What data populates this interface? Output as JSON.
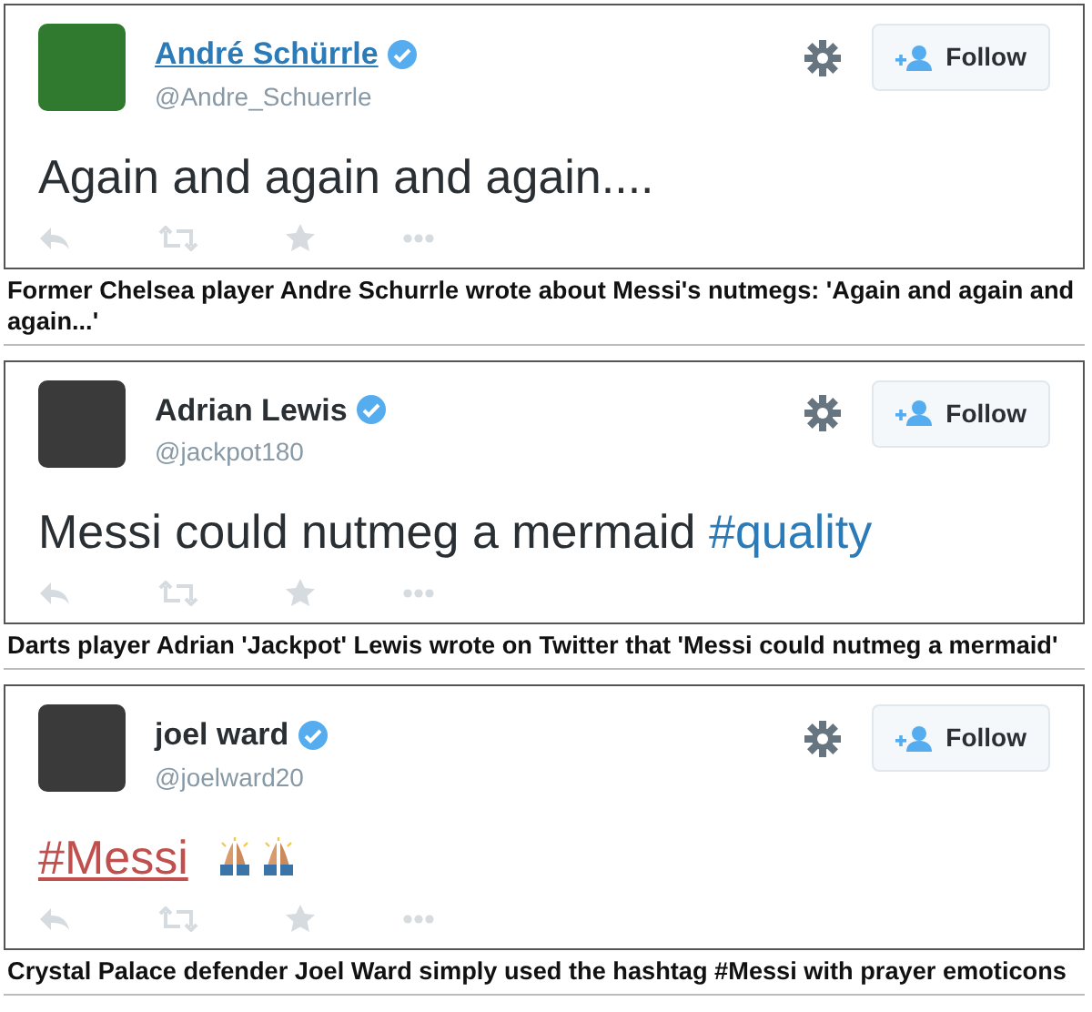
{
  "embeds": [
    {
      "tweet": {
        "name": "André Schürrle",
        "name_hovered": true,
        "handle": "@Andre_Schuerrle",
        "verified": true,
        "follow_label": "Follow",
        "text": [
          {
            "kind": "plain",
            "t": "Again and again and again...."
          }
        ]
      },
      "caption": "Former Chelsea player Andre Schurrle wrote about Messi's nutmegs: 'Again and again and again...'"
    },
    {
      "tweet": {
        "name": "Adrian Lewis",
        "name_hovered": false,
        "handle": "@jackpot180",
        "verified": true,
        "follow_label": "Follow",
        "text": [
          {
            "kind": "plain",
            "t": "Messi could nutmeg a mermaid "
          },
          {
            "kind": "hashtag",
            "t": "#quality",
            "hovered": false
          }
        ]
      },
      "caption": "Darts player Adrian 'Jackpot' Lewis wrote on Twitter that 'Messi could nutmeg a mermaid'"
    },
    {
      "tweet": {
        "name": "joel ward",
        "name_hovered": false,
        "handle": "@joelward20",
        "verified": true,
        "follow_label": "Follow",
        "text": [
          {
            "kind": "hashtag",
            "t": "#Messi",
            "hovered": true
          },
          {
            "kind": "emoji"
          },
          {
            "kind": "emoji"
          }
        ]
      },
      "caption": "Crystal Palace defender Joel Ward simply used the hashtag #Messi with prayer emoticons"
    }
  ]
}
